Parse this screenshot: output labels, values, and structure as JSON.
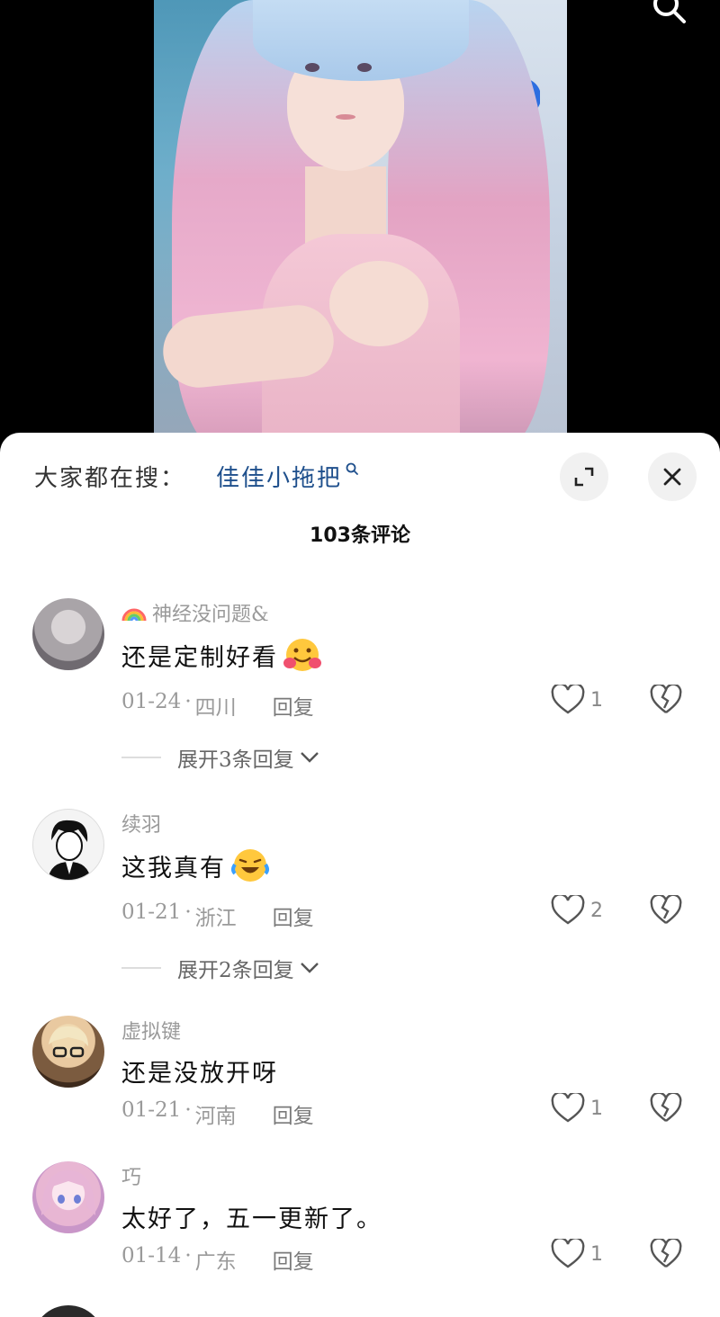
{
  "panel": {
    "hot_search_prefix": "大家都在搜：",
    "hot_search_keyword": "佳佳小拖把",
    "comment_count_title": "103条评论"
  },
  "comments": [
    {
      "user": "神经没问题&",
      "text": "还是定制好看",
      "date": "01-24",
      "location": "四川",
      "reply": "回复",
      "likes": "1",
      "expand": "展开3条回复"
    },
    {
      "user": "续羽",
      "text": "这我真有",
      "date": "01-21",
      "location": "浙江",
      "reply": "回复",
      "likes": "2",
      "expand": "展开2条回复"
    },
    {
      "user": "虚拟键",
      "text": "还是没放开呀",
      "date": "01-21",
      "location": "河南",
      "reply": "回复",
      "likes": "1"
    },
    {
      "user": "巧",
      "text": "太好了，五一更新了。",
      "date": "01-14",
      "location": "广东",
      "reply": "回复",
      "likes": "1"
    }
  ],
  "colors": {
    "keyword": "#1e4f8c",
    "meta": "#9a9a9a",
    "panel_bg": "#ffffff"
  },
  "icons": [
    "search-icon",
    "expand-icon",
    "close-icon",
    "heart-icon",
    "broken-heart-icon",
    "chevron-down-icon",
    "rainbow-icon"
  ]
}
